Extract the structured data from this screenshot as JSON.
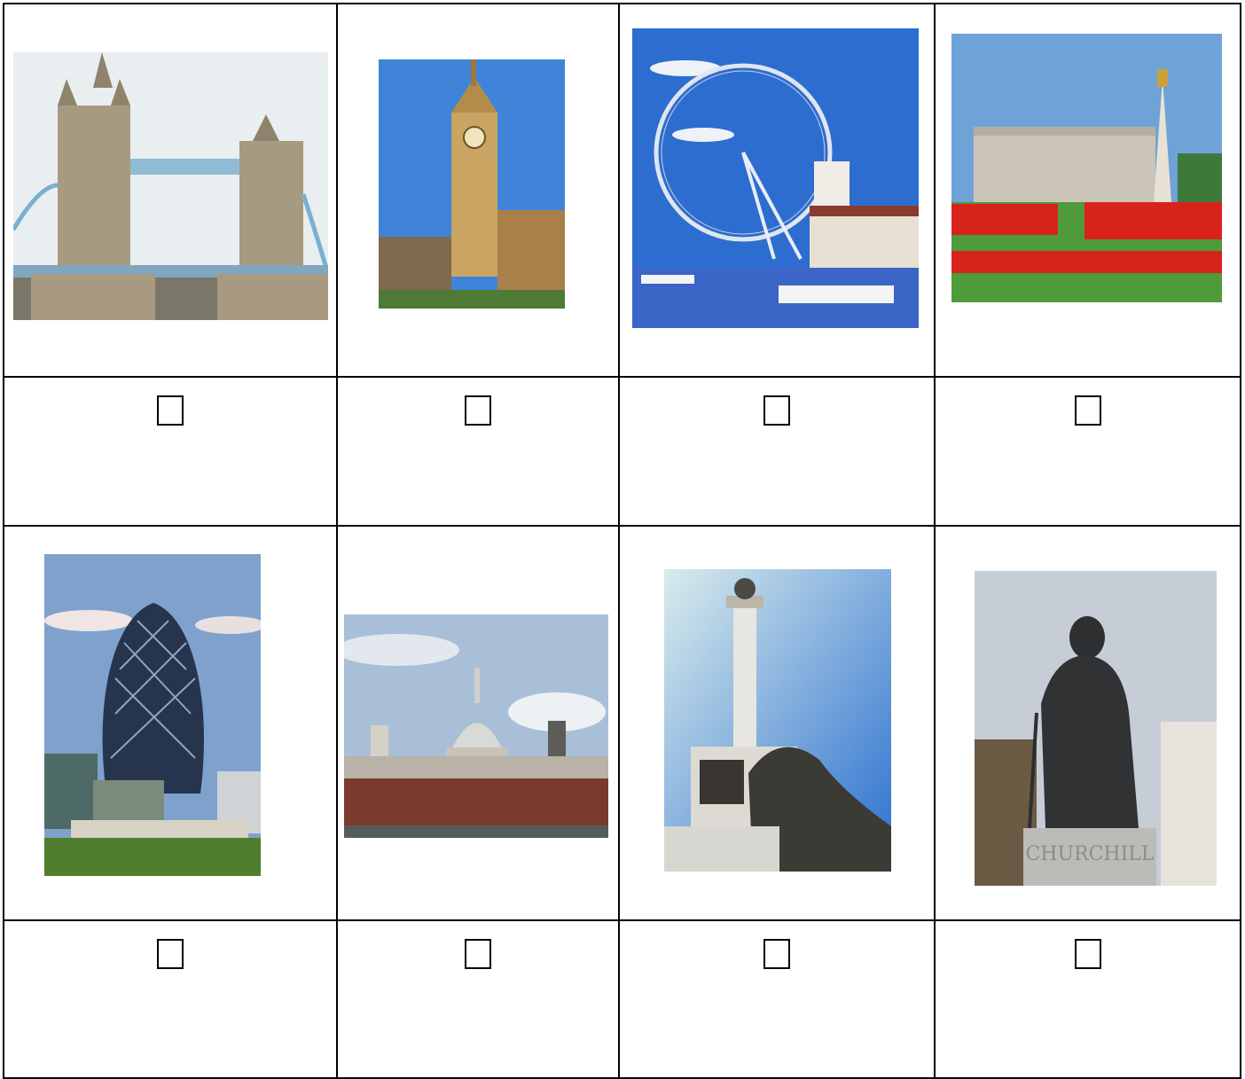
{
  "photos": [
    {
      "name": "tower-bridge-photo"
    },
    {
      "name": "big-ben-photo"
    },
    {
      "name": "london-eye-photo"
    },
    {
      "name": "buckingham-palace-photo"
    },
    {
      "name": "gherkin-photo"
    },
    {
      "name": "st-pauls-photo"
    },
    {
      "name": "nelsons-column-photo"
    },
    {
      "name": "churchill-statue-photo"
    }
  ],
  "statue_plinth_text": "CHURCHILL",
  "checkbox_glyph": "□",
  "colors": {
    "border": "#000000",
    "sky": "#6fa3d8",
    "grass": "#4f9a3a",
    "flowers": "#d8231c"
  }
}
